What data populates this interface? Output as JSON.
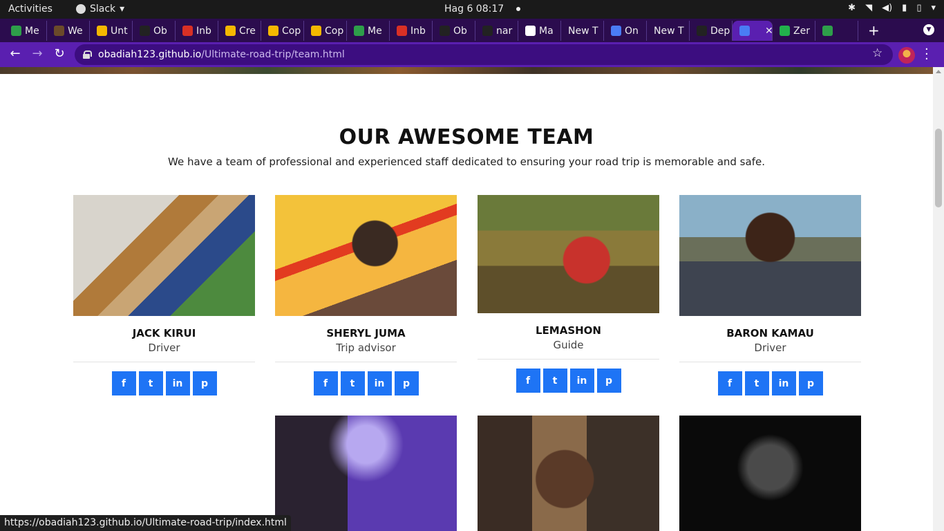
{
  "topbar": {
    "activities": "Activities",
    "app_name": "Slack",
    "clock": "Hag 6  08:17"
  },
  "tabs": [
    {
      "label": "Me",
      "color": "#2e9e4a"
    },
    {
      "label": "We",
      "color": "#6b4a2a"
    },
    {
      "label": "Unt",
      "color": "#f5b800"
    },
    {
      "label": "Ob",
      "color": "#222222"
    },
    {
      "label": "Inb",
      "color": "#d93025"
    },
    {
      "label": "Cre",
      "color": "#f5b800"
    },
    {
      "label": "Cop",
      "color": "#f5b800"
    },
    {
      "label": "Cop",
      "color": "#f5b800"
    },
    {
      "label": "Me",
      "color": "#2e9e4a"
    },
    {
      "label": "Inb",
      "color": "#d93025"
    },
    {
      "label": "Ob",
      "color": "#222222"
    },
    {
      "label": "nar",
      "color": "#222222"
    },
    {
      "label": "Ma",
      "color": "#ffffff"
    },
    {
      "label": "New T",
      "color": ""
    },
    {
      "label": "On",
      "color": "#4a7cf5"
    },
    {
      "label": "New T",
      "color": ""
    },
    {
      "label": "Dep",
      "color": "#222222"
    },
    {
      "label": "",
      "color": "#4a7cf5",
      "active": true
    },
    {
      "label": "Zer",
      "color": "#22b14c"
    },
    {
      "label": "",
      "color": "#2e9e4a"
    }
  ],
  "toolbar": {
    "url_host": "obadiah123.github.io",
    "url_path": "/Ultimate-road-trip/team.html"
  },
  "page": {
    "heading": "OUR AWESOME TEAM",
    "subheading": "We have a team of professional and experienced staff dedicated to ensuring your road trip is memorable and safe."
  },
  "team": [
    {
      "name": "JACK KIRUI",
      "role": "Driver"
    },
    {
      "name": "SHERYL JUMA",
      "role": "Trip advisor"
    },
    {
      "name": "LEMASHON",
      "role": "Guide"
    },
    {
      "name": "BARON KAMAU",
      "role": "Driver"
    }
  ],
  "socials": [
    "f",
    "t",
    "in",
    "p"
  ],
  "statusbar": "https://obadiah123.github.io/Ultimate-road-trip/index.html"
}
